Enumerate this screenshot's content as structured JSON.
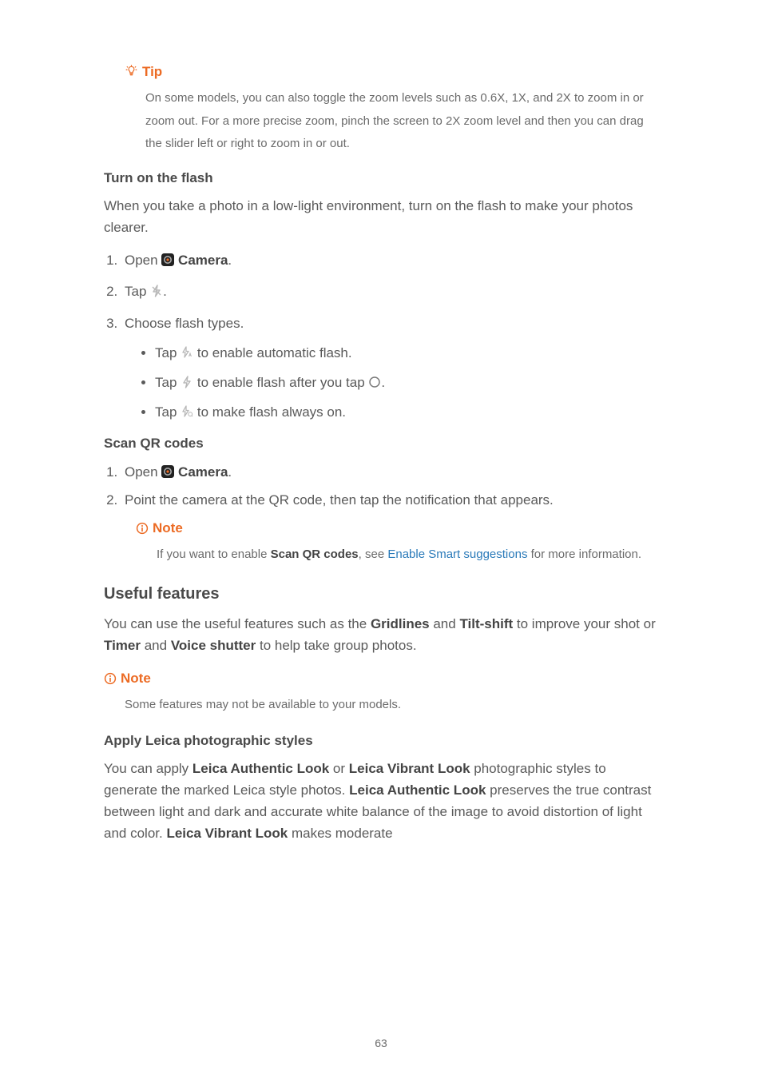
{
  "tip": {
    "label": "Tip",
    "body": "On some models, you can also toggle the zoom levels such as 0.6X, 1X, and 2X to zoom in or zoom out. For a more precise zoom, pinch the screen to 2X zoom level and then you can drag the slider left or right to zoom in or out."
  },
  "section_flash": {
    "heading": "Turn on the flash",
    "intro": "When you take a photo in a low-light environment, turn on the flash to make your photos clearer.",
    "step1_a": "Open ",
    "step1_b": "Camera",
    "step1_c": ".",
    "step2_a": "Tap ",
    "step2_b": ".",
    "step3": "Choose flash types.",
    "bullet1_a": "Tap ",
    "bullet1_b": " to enable automatic flash.",
    "bullet2_a": "Tap ",
    "bullet2_b": " to enable flash after you tap ",
    "bullet2_c": ".",
    "bullet3_a": "Tap ",
    "bullet3_b": " to make flash always on."
  },
  "section_qr": {
    "heading": "Scan QR codes",
    "step1_a": "Open ",
    "step1_b": "Camera",
    "step1_c": ".",
    "step2": "Point the camera at the QR code, then tap the notification that appears.",
    "note_label": "Note",
    "note_a": "If you want to enable ",
    "note_bold": "Scan QR codes",
    "note_b": ", see ",
    "note_link": "Enable Smart suggestions",
    "note_c": " for more information."
  },
  "section_useful": {
    "heading": "Useful features",
    "para_a": "You can use the useful features such as the ",
    "para_b": "Gridlines",
    "para_c": " and ",
    "para_d": "Tilt-shift",
    "para_e": " to improve your shot or ",
    "para_f": "Timer",
    "para_g": " and ",
    "para_h": "Voice shutter",
    "para_i": " to help take group photos.",
    "note_label": "Note",
    "note_body": "Some features may not be available to your models."
  },
  "section_leica": {
    "heading": "Apply Leica photographic styles",
    "p_a": "You can apply ",
    "p_b": "Leica Authentic Look",
    "p_c": " or ",
    "p_d": "Leica Vibrant Look",
    "p_e": " photographic styles to generate the marked Leica style photos. ",
    "p_f": "Leica Authentic Look",
    "p_g": " preserves the true contrast between light and dark and accurate white balance of the image to avoid distortion of light and color. ",
    "p_h": "Leica Vibrant Look",
    "p_i": " makes moderate"
  },
  "page_number": "63"
}
